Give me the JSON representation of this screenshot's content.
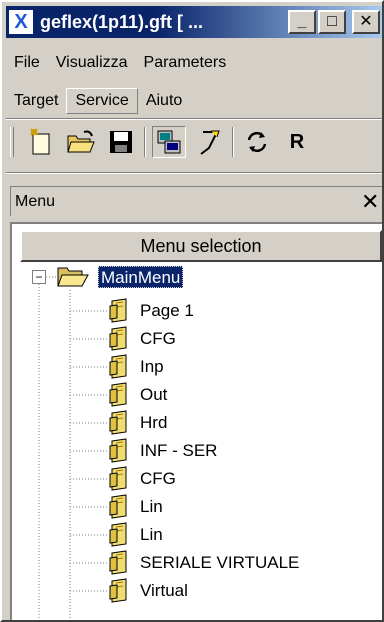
{
  "window": {
    "title": "geflex(1p11).gft [ ...",
    "minimize_glyph": "_",
    "maximize_glyph": "□",
    "close_glyph": "✕",
    "app_icon_glyph": "X"
  },
  "menubar": {
    "row1": [
      "File",
      "Visualizza",
      "Parameters"
    ],
    "row2": [
      "Target",
      "Service",
      "Aiuto"
    ]
  },
  "toolbar": {
    "buttons": [
      "new-icon",
      "open-icon",
      "save-icon",
      "target-icon",
      "wand-icon",
      "refresh-icon"
    ],
    "r_label": "R"
  },
  "panel": {
    "title": "Menu",
    "close_glyph": "✕"
  },
  "tree": {
    "header": "Menu selection",
    "root": "MainMenu",
    "expander_glyph": "−",
    "items": [
      "Page 1",
      "CFG",
      "Inp",
      "Out",
      "Hrd",
      "INF - SER",
      "CFG",
      "Lin",
      "Lin",
      "SERIALE VIRTUALE",
      "Virtual"
    ]
  },
  "colors": {
    "titlebar_start": "#0a246a",
    "titlebar_end": "#a6caf0",
    "selection": "#0a246a",
    "face": "#d4d0c8"
  }
}
